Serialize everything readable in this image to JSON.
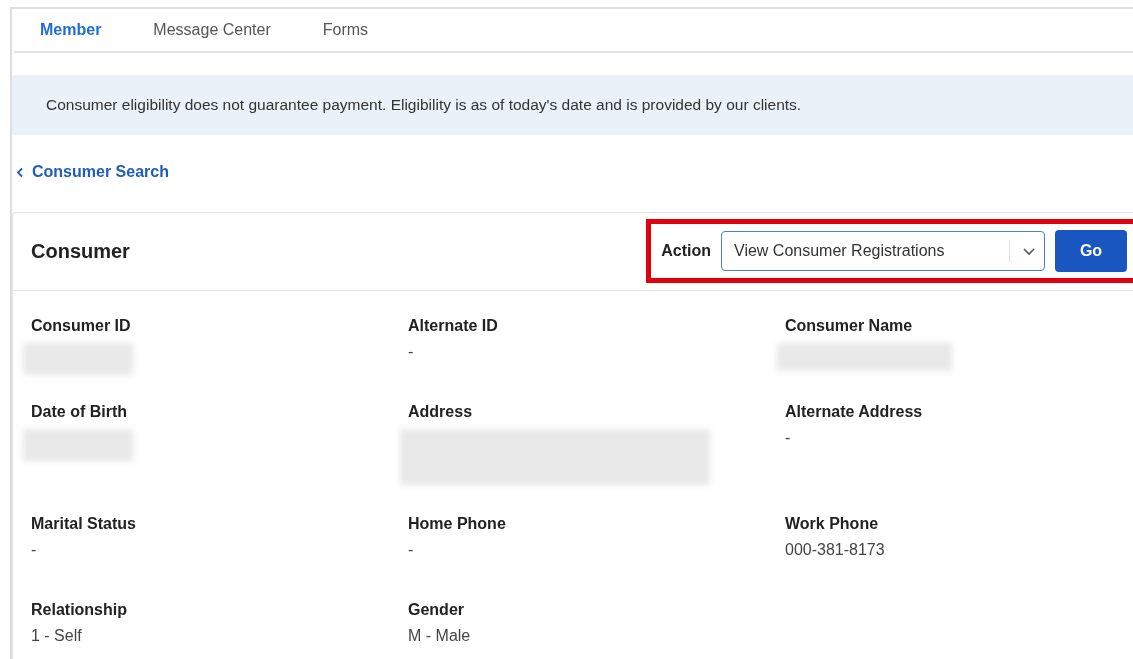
{
  "tabs": [
    {
      "label": "Member",
      "selected": true
    },
    {
      "label": "Message Center",
      "selected": false
    },
    {
      "label": "Forms",
      "selected": false
    }
  ],
  "notice": "Consumer eligibility does not guarantee payment. Eligibility is as of today's date and is provided by our clients.",
  "back_link": "Consumer Search",
  "card": {
    "title": "Consumer",
    "action": {
      "label": "Action",
      "value": "View Consumer Registrations",
      "button": "Go",
      "highlighted": true
    },
    "fields": [
      {
        "label": "Consumer ID",
        "redacted": true
      },
      {
        "label": "Alternate ID",
        "value": "-"
      },
      {
        "label": "Consumer Name",
        "redacted": true
      },
      {
        "label": "Date of Birth",
        "redacted": true
      },
      {
        "label": "Address",
        "redacted": true
      },
      {
        "label": "Alternate Address",
        "value": "-"
      },
      {
        "label": "Marital Status",
        "value": "-"
      },
      {
        "label": "Home Phone",
        "value": "-"
      },
      {
        "label": "Work Phone",
        "value": "000-381-8173"
      },
      {
        "label": "Relationship",
        "value": "1 - Self"
      },
      {
        "label": "Gender",
        "value": "M - Male"
      }
    ]
  }
}
